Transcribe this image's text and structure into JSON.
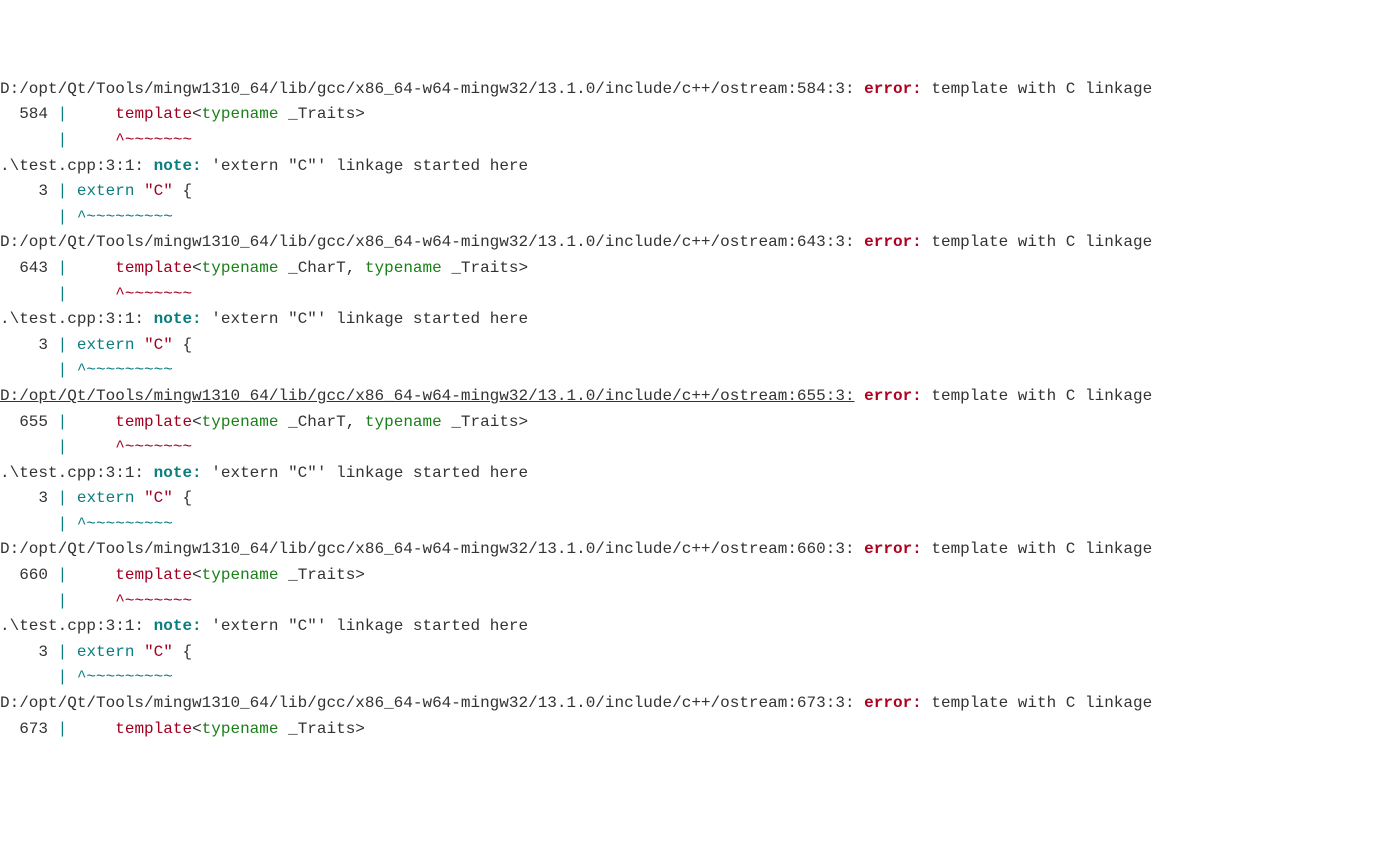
{
  "blocks": [
    {
      "loc": "D:/opt/Qt/Tools/mingw1310_64/lib/gcc/x86_64-w64-mingw32/13.1.0/include/c++/ostream:584:3:",
      "loc_underline": false,
      "err_label": "error:",
      "err_msg": "template with C linkage",
      "lineno": "584",
      "pipe": "|",
      "code_template": "template",
      "code_typename": "typename",
      "code_tail": " _Traits>",
      "wave": "^~~~~~~~",
      "note_loc": ".\\test.cpp:3:1:",
      "note_label": "note:",
      "note_msg": "'extern \"C\"' linkage started here",
      "note_lineno": "3",
      "note_extern": "extern",
      "note_str": "\"C\"",
      "note_brace": " {",
      "note_wave": "^~~~~~~~~~"
    },
    {
      "loc": "D:/opt/Qt/Tools/mingw1310_64/lib/gcc/x86_64-w64-mingw32/13.1.0/include/c++/ostream:643:3:",
      "loc_underline": false,
      "err_label": "error:",
      "err_msg": "template with C linkage",
      "lineno": "643",
      "pipe": "|",
      "code_template": "template",
      "code_typename": "typename",
      "code_typename2": "typename",
      "code_chart": " _CharT, ",
      "code_tail": " _Traits>",
      "wave": "^~~~~~~~",
      "note_loc": ".\\test.cpp:3:1:",
      "note_label": "note:",
      "note_msg": "'extern \"C\"' linkage started here",
      "note_lineno": "3",
      "note_extern": "extern",
      "note_str": "\"C\"",
      "note_brace": " {",
      "note_wave": "^~~~~~~~~~"
    },
    {
      "loc": "D:/opt/Qt/Tools/mingw1310_64/lib/gcc/x86_64-w64-mingw32/13.1.0/include/c++/ostream:655:3:",
      "loc_underline": true,
      "err_label": "error:",
      "err_msg": "template with C linkage",
      "lineno": "655",
      "pipe": "|",
      "code_template": "template",
      "code_typename": "typename",
      "code_typename2": "typename",
      "code_chart": " _CharT, ",
      "code_tail": " _Traits>",
      "wave": "^~~~~~~~",
      "note_loc": ".\\test.cpp:3:1:",
      "note_label": "note:",
      "note_msg": "'extern \"C\"' linkage started here",
      "note_lineno": "3",
      "note_extern": "extern",
      "note_str": "\"C\"",
      "note_brace": " {",
      "note_wave": "^~~~~~~~~~"
    },
    {
      "loc": "D:/opt/Qt/Tools/mingw1310_64/lib/gcc/x86_64-w64-mingw32/13.1.0/include/c++/ostream:660:3:",
      "loc_underline": false,
      "err_label": "error:",
      "err_msg": "template with C linkage",
      "lineno": "660",
      "pipe": "|",
      "code_template": "template",
      "code_typename": "typename",
      "code_tail": " _Traits>",
      "wave": "^~~~~~~~",
      "note_loc": ".\\test.cpp:3:1:",
      "note_label": "note:",
      "note_msg": "'extern \"C\"' linkage started here",
      "note_lineno": "3",
      "note_extern": "extern",
      "note_str": "\"C\"",
      "note_brace": " {",
      "note_wave": "^~~~~~~~~~"
    },
    {
      "loc": "D:/opt/Qt/Tools/mingw1310_64/lib/gcc/x86_64-w64-mingw32/13.1.0/include/c++/ostream:673:3:",
      "loc_underline": false,
      "err_label": "error:",
      "err_msg": "template with C linkage",
      "lineno": "673",
      "pipe": "|",
      "code_template": "template",
      "code_typename": "typename",
      "code_tail": " _Traits>",
      "partial": true
    }
  ]
}
